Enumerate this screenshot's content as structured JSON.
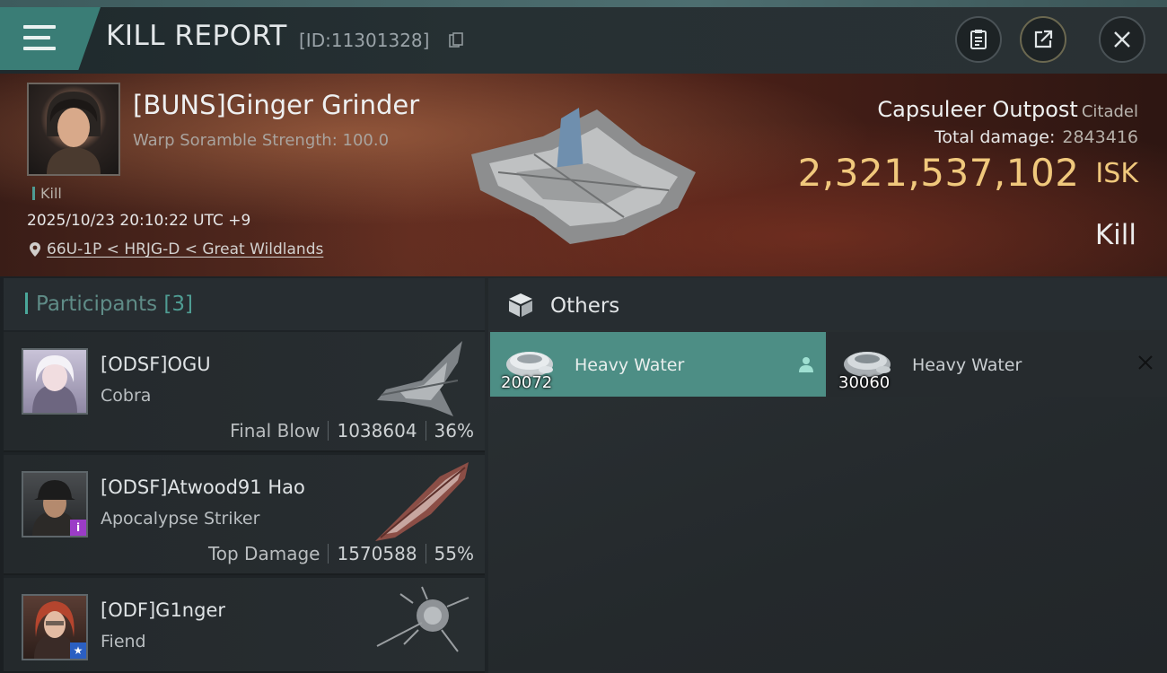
{
  "header": {
    "title": "KILL REPORT",
    "report_id": "[ID:11301328]",
    "icons": [
      "menu-icon",
      "copy-icon",
      "clipboard-icon",
      "share-icon",
      "close-icon"
    ]
  },
  "victim": {
    "name": "[BUNS]Ginger Grinder",
    "subtitle": "Warp Soramble Strength: 100.0",
    "tag": "Kill",
    "datetime": "2025/10/23 20:10:22 UTC +9",
    "location": "66U-1P < HRJG-D < Great Wildlands",
    "structure_name": "Capsuleer Outpost",
    "structure_class": "Citadel",
    "total_damage_label": "Total damage:",
    "total_damage": "2843416",
    "isk_value": "2,321,537,102",
    "isk_unit": "ISK",
    "result": "Kill"
  },
  "participants": {
    "title": "Participants",
    "count": "[3]",
    "rows": [
      {
        "name": "[ODSF]OGU",
        "ship": "Cobra",
        "label": "Final Blow",
        "damage": "1038604",
        "percent": "36%"
      },
      {
        "name": "[ODSF]Atwood91 Hao",
        "ship": "Apocalypse Striker",
        "label": "Top Damage",
        "damage": "1570588",
        "percent": "55%",
        "badge": "i"
      },
      {
        "name": "[ODF]G1nger",
        "ship": "Fiend",
        "badge": "★"
      }
    ]
  },
  "others": {
    "title": "Others",
    "items": [
      {
        "name": "Heavy Water",
        "qty": "20072",
        "selected": true
      },
      {
        "name": "Heavy Water",
        "qty": "30060",
        "selected": false
      }
    ]
  },
  "colors": {
    "accent_teal": "#4d8e85",
    "isk_gold": "#f0c87c",
    "banner_red": "#5b2c20"
  }
}
